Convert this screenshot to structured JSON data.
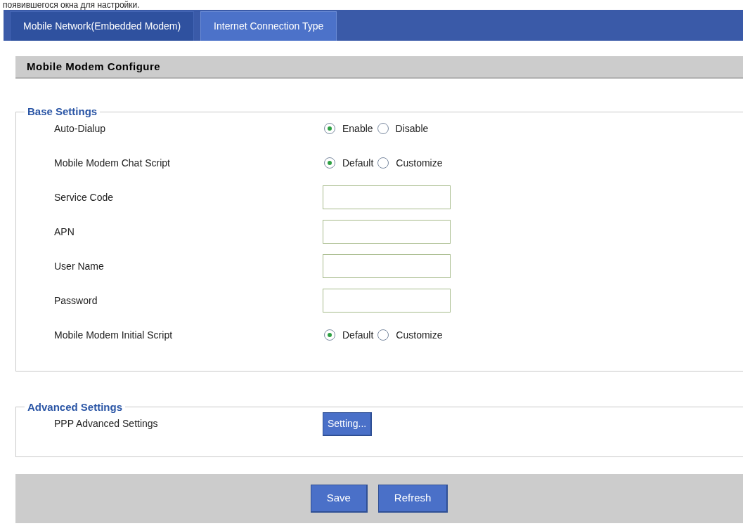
{
  "caption": "появившегося окна для настройки.",
  "tabs": [
    {
      "label": "Mobile Network(Embedded Modem)",
      "selected": true
    },
    {
      "label": "Internet Connection Type",
      "selected": false
    }
  ],
  "header": "Mobile Modem Configure",
  "sections": [
    {
      "legend": "Base Settings",
      "rows": [
        {
          "kind": "radio",
          "label": "Auto-Dialup",
          "options": [
            {
              "label": "Enable",
              "selected": true
            },
            {
              "label": "Disable",
              "selected": false
            }
          ]
        },
        {
          "kind": "radio",
          "label": "Mobile Modem Chat Script",
          "options": [
            {
              "label": "Default",
              "selected": true
            },
            {
              "label": "Customize",
              "selected": false
            }
          ]
        },
        {
          "kind": "input",
          "label": "Service Code"
        },
        {
          "kind": "input",
          "label": "APN"
        },
        {
          "kind": "input",
          "label": "User Name"
        },
        {
          "kind": "input",
          "label": "Password"
        },
        {
          "kind": "radio",
          "label": "Mobile Modem Initial Script",
          "options": [
            {
              "label": "Default",
              "selected": true
            },
            {
              "label": "Customize",
              "selected": false
            }
          ]
        }
      ]
    },
    {
      "legend": "Advanced Settings",
      "rows": [
        {
          "kind": "button",
          "label": "PPP Advanced Settings",
          "button": "Setting..."
        }
      ]
    }
  ],
  "buttons": [
    "Save",
    "Refresh"
  ]
}
